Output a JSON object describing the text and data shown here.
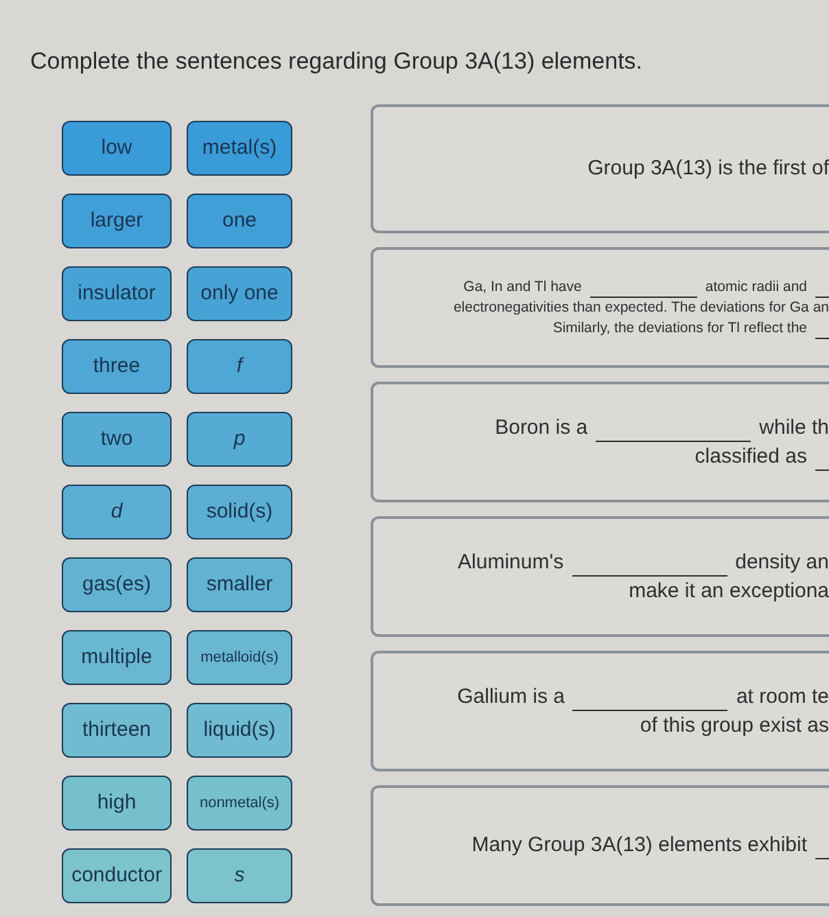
{
  "instruction": "Complete the sentences regarding Group 3A(13) elements.",
  "word_bank": [
    {
      "text": "low",
      "italic": false
    },
    {
      "text": "metal(s)",
      "italic": false
    },
    {
      "text": "larger",
      "italic": false
    },
    {
      "text": "one",
      "italic": false
    },
    {
      "text": "insulator",
      "italic": false
    },
    {
      "text": "only one",
      "italic": false
    },
    {
      "text": "three",
      "italic": false
    },
    {
      "text": "f",
      "italic": true
    },
    {
      "text": "two",
      "italic": false
    },
    {
      "text": "p",
      "italic": true
    },
    {
      "text": "d",
      "italic": true
    },
    {
      "text": "solid(s)",
      "italic": false
    },
    {
      "text": "gas(es)",
      "italic": false
    },
    {
      "text": "smaller",
      "italic": false
    },
    {
      "text": "multiple",
      "italic": false
    },
    {
      "text": "metalloid(s)",
      "italic": false
    },
    {
      "text": "thirteen",
      "italic": false
    },
    {
      "text": "liquid(s)",
      "italic": false
    },
    {
      "text": "high",
      "italic": false
    },
    {
      "text": "nonmetal(s)",
      "italic": false
    },
    {
      "text": "conductor",
      "italic": false
    },
    {
      "text": "s",
      "italic": true
    }
  ],
  "sentences": [
    {
      "lines": [
        [
          {
            "kind": "text",
            "text": "Group 3A(13) is the first of"
          }
        ]
      ]
    },
    {
      "lines": [
        [
          {
            "kind": "text",
            "text": "Ga, In and Tl have"
          },
          {
            "kind": "blank"
          },
          {
            "kind": "text",
            "text": "atomic radii and"
          },
          {
            "kind": "blank"
          }
        ],
        [
          {
            "kind": "text",
            "text": "electronegativities than expected. The deviations for Ga an"
          }
        ],
        [
          {
            "kind": "text",
            "text": "Similarly, the deviations for Tl reflect the"
          },
          {
            "kind": "blank"
          }
        ]
      ]
    },
    {
      "lines": [
        [
          {
            "kind": "text",
            "text": "Boron is a"
          },
          {
            "kind": "blank"
          },
          {
            "kind": "text",
            "text": "while th"
          }
        ],
        [
          {
            "kind": "text",
            "text": "classified as"
          },
          {
            "kind": "blank"
          }
        ]
      ]
    },
    {
      "lines": [
        [
          {
            "kind": "text",
            "text": "Aluminum's"
          },
          {
            "kind": "blank"
          },
          {
            "kind": "text",
            "text": "density an"
          }
        ],
        [
          {
            "kind": "text",
            "text": "make it an exceptiona"
          }
        ]
      ]
    },
    {
      "lines": [
        [
          {
            "kind": "text",
            "text": "Gallium is a"
          },
          {
            "kind": "blank"
          },
          {
            "kind": "text",
            "text": "at room te"
          }
        ],
        [
          {
            "kind": "text",
            "text": "of this group exist as"
          }
        ]
      ]
    },
    {
      "lines": [
        [
          {
            "kind": "text",
            "text": "Many Group 3A(13) elements exhibit"
          },
          {
            "kind": "blank"
          }
        ]
      ]
    }
  ]
}
